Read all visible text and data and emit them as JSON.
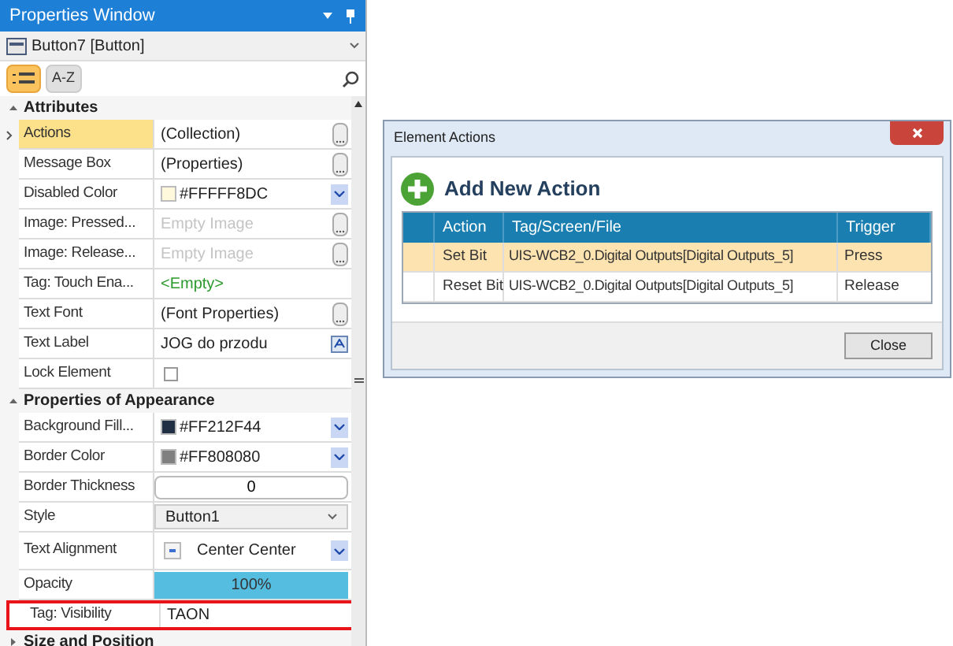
{
  "properties_window": {
    "title": "Properties Window",
    "object_selector": "Button7 [Button]",
    "sort_buttons": [
      {
        "label": "A-Z",
        "selected": false
      }
    ],
    "category_button": {
      "selected": true
    },
    "sections": [
      {
        "title": "Attributes",
        "expanded": true,
        "rows": [
          {
            "label": "Actions",
            "value": "(Collection)",
            "kind": "ellipsis",
            "selected": true,
            "highlighted": false
          },
          {
            "label": "Message Box",
            "value": "(Properties)",
            "kind": "ellipsis",
            "selected": false,
            "highlighted": false
          },
          {
            "label": "Disabled Color",
            "value": "#FFFFF8DC",
            "kind": "color",
            "color": "#fff8dc",
            "selected": false,
            "highlighted": false
          },
          {
            "label": "Image: Pressed...",
            "placeholder": "Empty Image",
            "kind": "image",
            "selected": false,
            "highlighted": false
          },
          {
            "label": "Image: Release...",
            "placeholder": "Empty Image",
            "kind": "image",
            "selected": false,
            "highlighted": false
          },
          {
            "label": "Tag: Touch Ena...",
            "value": "<Empty>",
            "kind": "tag",
            "selected": false,
            "highlighted": false
          },
          {
            "label": "Text Font",
            "value": "(Font Properties)",
            "kind": "ellipsis",
            "selected": false,
            "highlighted": false
          },
          {
            "label": "Text Label",
            "value": "JOG do przodu",
            "kind": "text",
            "selected": false,
            "highlighted": false
          },
          {
            "label": "Lock Element",
            "kind": "checkbox",
            "checked": false,
            "selected": false,
            "highlighted": false
          }
        ]
      },
      {
        "title": "Properties of Appearance",
        "expanded": true,
        "rows": [
          {
            "label": "Background Fill...",
            "value": "#FF212F44",
            "kind": "color",
            "color": "#212f44",
            "selected": false,
            "highlighted": false
          },
          {
            "label": "Border Color",
            "value": "#FF808080",
            "kind": "color",
            "color": "#808080",
            "selected": false,
            "highlighted": false
          },
          {
            "label": "Border Thickness",
            "value": "0",
            "kind": "number",
            "selected": false,
            "highlighted": false
          },
          {
            "label": "Style",
            "value": "Button1",
            "kind": "select",
            "selected": false,
            "highlighted": false
          },
          {
            "label": "Text Alignment",
            "value": "Center Center",
            "kind": "align",
            "selected": false,
            "highlighted": false
          },
          {
            "label": "Opacity",
            "value": "100%",
            "kind": "level",
            "level": 1,
            "selected": false,
            "highlighted": false
          },
          {
            "label": "Tag: Visibility",
            "value": "TAON",
            "kind": "plain",
            "selected": false,
            "highlighted": true
          }
        ]
      },
      {
        "title": "Size and Position",
        "expanded": false
      }
    ]
  },
  "dialog": {
    "title": "Element Actions",
    "add_button": "Add New Action",
    "columns": [
      "Action",
      "Tag/Screen/File",
      "Trigger"
    ],
    "rows": [
      {
        "action": "Set Bit",
        "tag": "UIS-WCB2_0.Digital Outputs[Digital Outputs_5]",
        "trigger": "Press",
        "selected": true
      },
      {
        "action": "Reset Bit",
        "tag": "UIS-WCB2_0.Digital Outputs[Digital Outputs_5]",
        "trigger": "Release",
        "selected": false
      }
    ],
    "close_button": "Close"
  }
}
